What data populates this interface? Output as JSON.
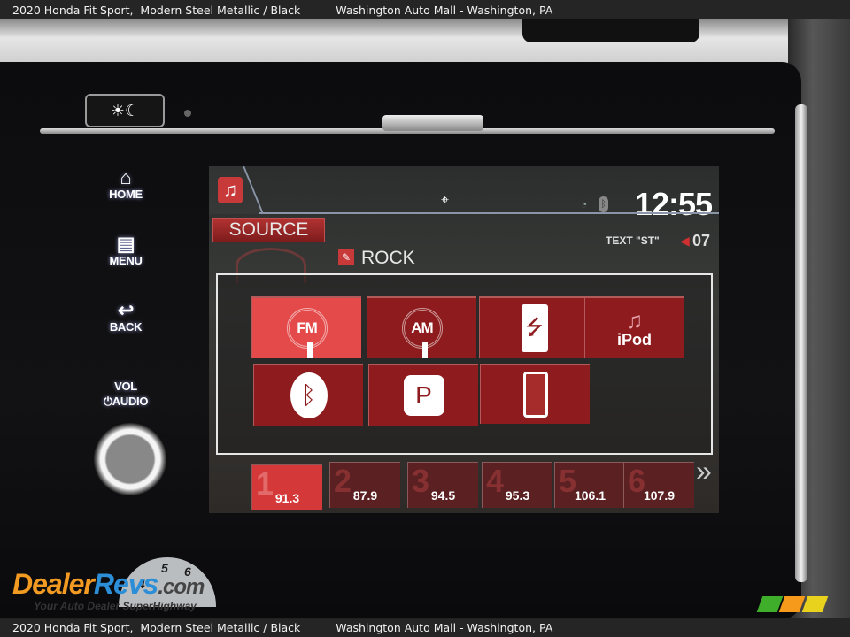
{
  "caption": {
    "vehicle": "2020 Honda Fit Sport,  Modern Steel Metallic / Black",
    "dealer": "Washington Auto Mall - Washington, PA"
  },
  "hardware_buttons": {
    "day_night": "☀☾",
    "home": {
      "icon": "house-icon",
      "glyph": "⌂",
      "label": "HOME"
    },
    "menu": {
      "icon": "menu-icon",
      "glyph": "▤",
      "label": "MENU"
    },
    "back": {
      "icon": "back-arrow-icon",
      "glyph": "↩",
      "label": "BACK"
    },
    "vol": {
      "line1": "VOL",
      "line2": "⏻AUDIO"
    }
  },
  "status_bar": {
    "app_icon_glyph": "♫",
    "nav_glyph": "⌖",
    "signal_glyph": "◔",
    "bluetooth_glyph": "ᛒ",
    "clock": "12:55"
  },
  "audio": {
    "source_label": "SOURCE",
    "genre_glyph": "✎",
    "genre": "ROCK",
    "rds_text": "TEXT \"ST\"",
    "volume_glyph": "◀",
    "volume": "07"
  },
  "sources": [
    {
      "id": "fm",
      "label": "FM",
      "active": true
    },
    {
      "id": "am",
      "label": "AM",
      "active": false
    },
    {
      "id": "usb",
      "glyph": "⭍",
      "active": false
    },
    {
      "id": "ipod",
      "glyph": "♫",
      "label": "iPod",
      "active": false
    },
    {
      "id": "bluetooth",
      "glyph": "ᛒ",
      "active": false
    },
    {
      "id": "pandora",
      "glyph": "P",
      "active": false
    },
    {
      "id": "phone",
      "active": false
    }
  ],
  "presets": [
    {
      "num": "1",
      "freq": "91.3",
      "active": true
    },
    {
      "num": "2",
      "freq": "87.9",
      "active": false
    },
    {
      "num": "3",
      "freq": "94.5",
      "active": false
    },
    {
      "num": "4",
      "freq": "95.3",
      "active": false
    },
    {
      "num": "5",
      "freq": "106.1",
      "active": false
    },
    {
      "num": "6",
      "freq": "107.9",
      "active": false
    }
  ],
  "presets_next": "»",
  "watermark": {
    "brand_a": "Dealer",
    "brand_b": "Revs",
    "brand_c": ".com",
    "tagline": "Your Auto Dealer SuperHighway",
    "gauge": [
      "4",
      "5",
      "6"
    ],
    "stripe_colors": [
      "#3fae2a",
      "#f59a1a",
      "#e8d21e"
    ]
  }
}
